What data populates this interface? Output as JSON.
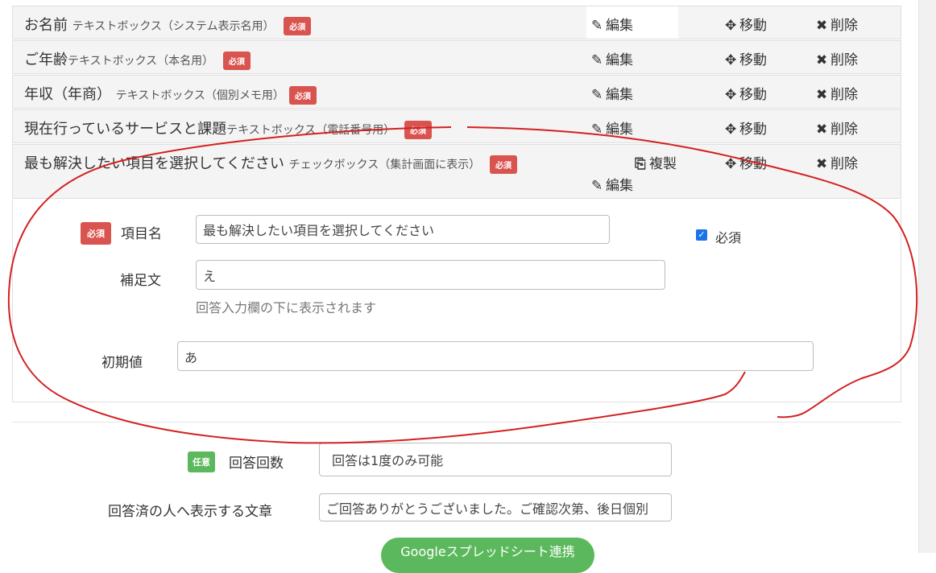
{
  "fields": [
    {
      "label": "お名前",
      "type": "テキストボックス（システム表示名用）",
      "badge": "必須"
    },
    {
      "label": "ご年齢",
      "type": "テキストボックス（本名用）",
      "badge": "必須"
    },
    {
      "label": "年収（年商）",
      "type": "テキストボックス（個別メモ用）",
      "badge": "必須"
    },
    {
      "label": "現在行っているサービスと課題",
      "type": "テキストボックス（電話番号用）",
      "badge": "必須"
    },
    {
      "label": "最も解決したい項目を選択してください",
      "type": "チェックボックス（集計画面に表示）",
      "badge": "必須"
    }
  ],
  "actions": {
    "edit": "編集",
    "move": "移動",
    "delete": "削除",
    "copy": "複製"
  },
  "editor": {
    "required_badge": "必須",
    "item_name_label": "項目名",
    "item_name_value": "最も解決したい項目を選択してください",
    "required_checkbox_label": "必須",
    "required_checked": true,
    "note_label": "補足文",
    "note_value": "え",
    "note_help": "回答入力欄の下に表示されます",
    "default_label": "初期値",
    "default_value": "あ"
  },
  "settings": {
    "optional_badge": "任意",
    "answer_count_label": "回答回数",
    "answer_count_value": "回答は1度のみ可能",
    "answered_message_label": "回答済の人へ表示する文章",
    "answered_message_value": "ご回答ありがとうございました。ご確認次第、後日個別",
    "sheet_button": "Googleスプレッドシート連携"
  }
}
